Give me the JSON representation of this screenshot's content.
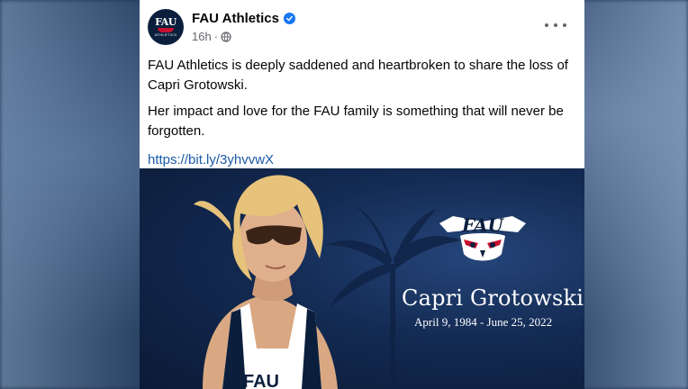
{
  "post": {
    "page_name": "FAU Athletics",
    "time": "16h",
    "separator": "·",
    "paragraph_1": "FAU Athletics is deeply saddened and heartbroken to share the loss of Capri Grotowski.",
    "paragraph_2": "Her impact and love for the FAU family is something that will never be forgotten.",
    "link": "https://bit.ly/3yhvvwX"
  },
  "avatar": {
    "text": "FAU",
    "subtext": "ATHLETICS"
  },
  "image": {
    "logo_text": "FAU",
    "name": "Capri Grotowski",
    "dates": "April 9, 1984 - June 25, 2022",
    "jersey_text": "FAU"
  },
  "icons": {
    "verified": "verified-badge-icon",
    "audience": "globe-icon",
    "more": "more-options-icon"
  },
  "colors": {
    "link": "#1a5aa6",
    "verified": "#1877f2",
    "navy": "#0b1f3d",
    "red": "#c8102e"
  }
}
